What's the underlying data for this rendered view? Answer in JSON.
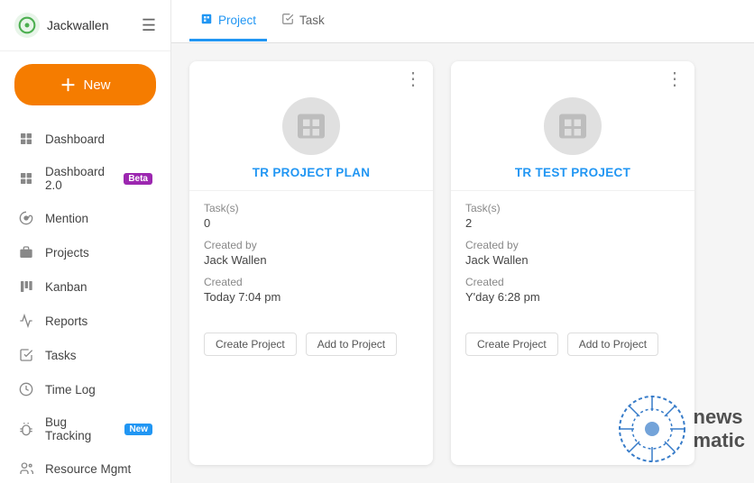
{
  "sidebar": {
    "username": "Jackwallen",
    "logo_icon": "○",
    "new_button_label": "New",
    "nav_items": [
      {
        "id": "dashboard",
        "label": "Dashboard",
        "icon": "grid"
      },
      {
        "id": "dashboard2",
        "label": "Dashboard 2.0",
        "icon": "grid",
        "badge": "Beta"
      },
      {
        "id": "mention",
        "label": "Mention",
        "icon": "at"
      },
      {
        "id": "projects",
        "label": "Projects",
        "icon": "briefcase"
      },
      {
        "id": "kanban",
        "label": "Kanban",
        "icon": "kanban"
      },
      {
        "id": "reports",
        "label": "Reports",
        "icon": "chart"
      },
      {
        "id": "tasks",
        "label": "Tasks",
        "icon": "check"
      },
      {
        "id": "timelog",
        "label": "Time Log",
        "icon": "clock"
      },
      {
        "id": "bugtracking",
        "label": "Bug Tracking",
        "icon": "bug",
        "badge": "New"
      },
      {
        "id": "resource",
        "label": "Resource Mgmt",
        "icon": "people"
      }
    ]
  },
  "tabs": [
    {
      "id": "project",
      "label": "Project",
      "icon": "📋",
      "active": true
    },
    {
      "id": "task",
      "label": "Task",
      "icon": "✅",
      "active": false
    }
  ],
  "projects": [
    {
      "id": "tr-project-plan",
      "title": "TR PROJECT PLAN",
      "tasks_label": "Task(s)",
      "tasks_count": "0",
      "created_by_label": "Created by",
      "created_by": "Jack Wallen",
      "created_label": "Created",
      "created_time": "Today 7:04 pm",
      "btn_create": "Create Project",
      "btn_add": "Add to Project"
    },
    {
      "id": "tr-test-project",
      "title": "TR TEST PROJECT",
      "tasks_label": "Task(s)",
      "tasks_count": "2",
      "created_by_label": "Created by",
      "created_by": "Jack Wallen",
      "created_label": "Created",
      "created_time": "Y'day 6:28 pm",
      "btn_create": "Create Project",
      "btn_add": "Add to Project"
    }
  ]
}
